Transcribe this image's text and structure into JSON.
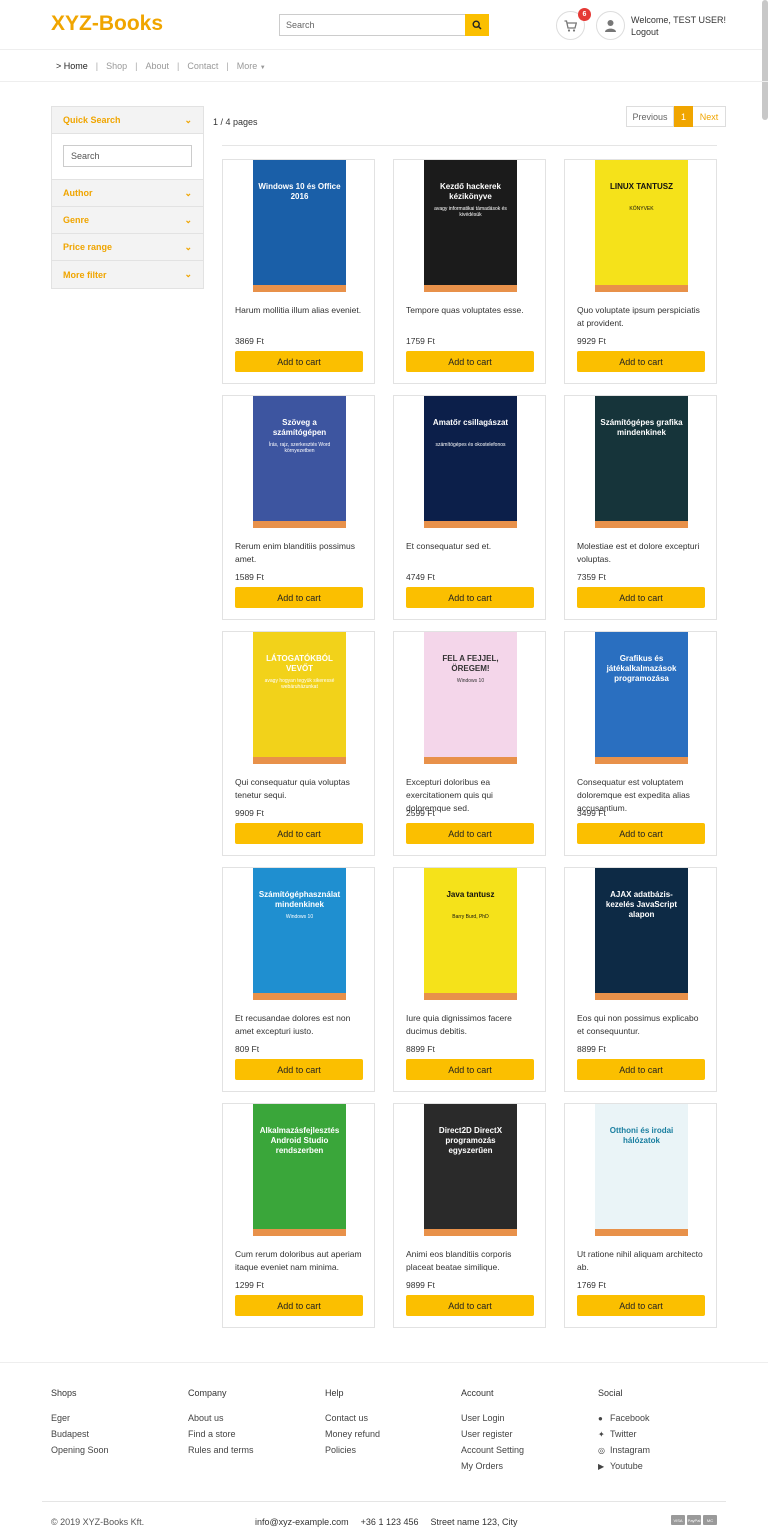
{
  "header": {
    "brand": "XYZ-Books",
    "search_placeholder": "Search",
    "cart_count": "6",
    "welcome": "Welcome, TEST USER!",
    "logout": "Logout"
  },
  "nav": {
    "items": [
      {
        "label": "Home",
        "prefix": ">"
      },
      {
        "label": "Shop"
      },
      {
        "label": "About"
      },
      {
        "label": "Contact"
      },
      {
        "label": "More"
      }
    ]
  },
  "sidebar": {
    "quick_search": "Quick Search",
    "search_placeholder": "Search",
    "filters": [
      "Author",
      "Genre",
      "Price range",
      "More filter"
    ]
  },
  "listing": {
    "pages": "1 / 4 pages",
    "previous": "Previous",
    "current": "1",
    "next": "Next",
    "add_to_cart": "Add to cart"
  },
  "products": [
    {
      "name": "Harum mollitia illum alias eveniet.",
      "price": "3869 Ft",
      "cover_title": "Windows 10 és Office 2016",
      "cover_sub": "",
      "bg": "#1a5fa8",
      "fg": "#ffffff"
    },
    {
      "name": "Tempore quas voluptates esse.",
      "price": "1759 Ft",
      "cover_title": "Kezdő hackerek kézikönyve",
      "cover_sub": "avagy informatikai támadások és kivédésük",
      "bg": "#1b1b1b",
      "fg": "#ffffff"
    },
    {
      "name": "Quo voluptate ipsum perspiciatis at provident.",
      "price": "9929 Ft",
      "cover_title": "LINUX TANTUSZ",
      "cover_sub": "KÖNYVEK",
      "bg": "#f5e21a",
      "fg": "#111111"
    },
    {
      "name": "Rerum enim blanditiis possimus amet.",
      "price": "1589 Ft",
      "cover_title": "Szöveg a számítógépen",
      "cover_sub": "Írás, rajz, szerkesztés Word környezetben",
      "bg": "#3d55a0",
      "fg": "#ffffff"
    },
    {
      "name": "Et consequatur sed et.",
      "price": "4749 Ft",
      "cover_title": "Amatőr csillagászat",
      "cover_sub": "számítógépes és okostelefonos",
      "bg": "#0c1f4a",
      "fg": "#ffffff"
    },
    {
      "name": "Molestiae est et dolore excepturi voluptas.",
      "price": "7359 Ft",
      "cover_title": "Számítógépes grafika mindenkinek",
      "cover_sub": "",
      "bg": "#16343a",
      "fg": "#ffffff"
    },
    {
      "name": "Qui consequatur quia voluptas tenetur sequi.",
      "price": "9909 Ft",
      "cover_title": "LÁTOGATÓKBÓL VEVŐT",
      "cover_sub": "avagy hogyan tegyük sikeressé webáruházunkat",
      "bg": "#f2d21a",
      "fg": "#ffffff"
    },
    {
      "name": "Excepturi doloribus ea exercitationem quis qui doloremque sed.",
      "price": "2599 Ft",
      "cover_title": "FEL A FEJJEL, ÖREGEM!",
      "cover_sub": "Windows 10",
      "bg": "#f4d6ea",
      "fg": "#333333"
    },
    {
      "name": "Consequatur est voluptatem doloremque est expedita alias accusantium.",
      "price": "3499 Ft",
      "cover_title": "Grafikus és játékalkalmazások programozása",
      "cover_sub": "",
      "bg": "#2a6fc0",
      "fg": "#ffffff"
    },
    {
      "name": "Et recusandae dolores est non amet excepturi iusto.",
      "price": "809 Ft",
      "cover_title": "Számítógéphasználat mindenkinek",
      "cover_sub": "Windows 10",
      "bg": "#1f8fd0",
      "fg": "#ffffff"
    },
    {
      "name": "Iure quia dignissimos facere ducimus debitis.",
      "price": "8899 Ft",
      "cover_title": "Java tantusz",
      "cover_sub": "Barry Burd, PhD",
      "bg": "#f5e21a",
      "fg": "#111111"
    },
    {
      "name": "Eos qui non possimus explicabo et consequuntur.",
      "price": "8899 Ft",
      "cover_title": "AJAX adatbázis-kezelés JavaScript alapon",
      "cover_sub": "",
      "bg": "#0d2a45",
      "fg": "#ffffff"
    },
    {
      "name": "Cum rerum doloribus aut aperiam itaque eveniet nam minima.",
      "price": "1299 Ft",
      "cover_title": "Alkalmazásfejlesztés Android Studio rendszerben",
      "cover_sub": "",
      "bg": "#3aa63a",
      "fg": "#ffffff"
    },
    {
      "name": "Animi eos blanditiis corporis placeat beatae similique.",
      "price": "9899 Ft",
      "cover_title": "Direct2D DirectX programozás egyszerűen",
      "cover_sub": "",
      "bg": "#2a2a2a",
      "fg": "#ffffff"
    },
    {
      "name": "Ut ratione nihil aliquam architecto ab.",
      "price": "1769 Ft",
      "cover_title": "Otthoni és irodai hálózatok",
      "cover_sub": "",
      "bg": "#eaf4f7",
      "fg": "#1a7fa0"
    }
  ],
  "footer": {
    "columns": [
      {
        "heading": "Shops",
        "links": [
          "Eger",
          "Budapest",
          "Opening Soon"
        ]
      },
      {
        "heading": "Company",
        "links": [
          "About us",
          "Find a store",
          "Rules and terms"
        ]
      },
      {
        "heading": "Help",
        "links": [
          "Contact us",
          "Money refund",
          "Policies"
        ]
      },
      {
        "heading": "Account",
        "links": [
          "User Login",
          "User register",
          "Account Setting",
          "My Orders"
        ]
      },
      {
        "heading": "Social",
        "links": [
          "Facebook",
          "Twitter",
          "Instagram",
          "Youtube"
        ]
      }
    ],
    "copyright": "© 2019 XYZ-Books Kft.",
    "email": "info@xyz-example.com",
    "phone": "+36 1 123 456",
    "address": "Street name 123, City",
    "payments": [
      "VISA",
      "PayPal",
      "MC"
    ]
  },
  "colors": {
    "accent": "#f0a500",
    "button": "#fbbf00",
    "badge": "#e53935"
  }
}
